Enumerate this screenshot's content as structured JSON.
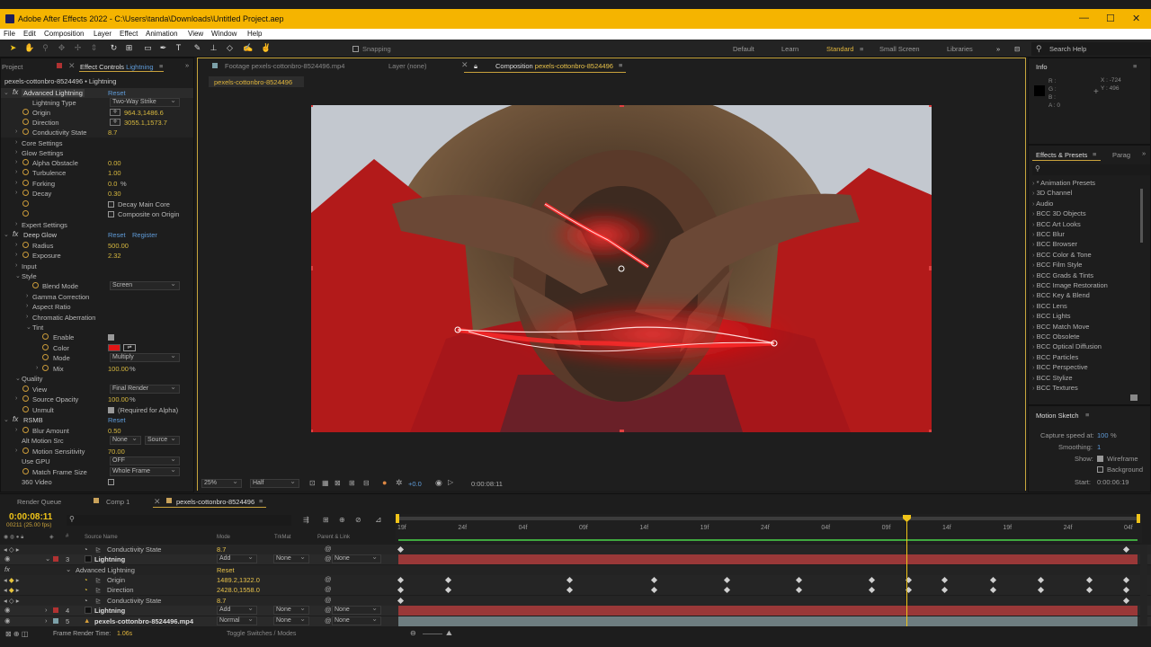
{
  "title": "Adobe After Effects 2022 - C:\\Users\\tanda\\Downloads\\Untitled Project.aep",
  "menu": [
    "File",
    "Edit",
    "Composition",
    "Layer",
    "Effect",
    "Animation",
    "View",
    "Window",
    "Help"
  ],
  "toolbar": {
    "snapping": "Snapping",
    "workspaces": [
      "Default",
      "Learn",
      "Standard",
      "Small Screen",
      "Libraries"
    ],
    "search": "Search Help"
  },
  "effect_controls": {
    "project_tab": "Project",
    "tab_prefix": "Effect Controls",
    "tab_layer": "Lightning",
    "header": "pexels-cottonbro-8524496 • Lightning",
    "advanced_lightning": "Advanced Lightning",
    "reset": "Reset",
    "register": "Register",
    "lightning_type": {
      "label": "Lightning Type",
      "value": "Two-Way Strike"
    },
    "origin": {
      "label": "Origin",
      "value": "964.3,1486.6"
    },
    "direction": {
      "label": "Direction",
      "value": "3055.1,1573.7"
    },
    "conductivity": {
      "label": "Conductivity State",
      "value": "8.7"
    },
    "core_settings": "Core Settings",
    "glow_settings": "Glow Settings",
    "alpha_obstacle": {
      "label": "Alpha Obstacle",
      "value": "0.00"
    },
    "turbulence": {
      "label": "Turbulence",
      "value": "1.00"
    },
    "forking": {
      "label": "Forking",
      "value": "0.0",
      "unit": "%"
    },
    "decay": {
      "label": "Decay",
      "value": "0.30"
    },
    "decay_main_core": "Decay Main Core",
    "composite_on_origin": "Composite on Origin",
    "expert_settings": "Expert Settings",
    "deep_glow": "Deep Glow",
    "radius": {
      "label": "Radius",
      "value": "500.00"
    },
    "exposure": {
      "label": "Exposure",
      "value": "2.32"
    },
    "input": "Input",
    "style": "Style",
    "blend_mode": {
      "label": "Blend Mode",
      "value": "Screen"
    },
    "gamma": "Gamma Correction",
    "aspect": "Aspect Ratio",
    "chromatic": "Chromatic Aberration",
    "tint": "Tint",
    "enable": "Enable",
    "color": "Color",
    "mode": {
      "label": "Mode",
      "value": "Multiply"
    },
    "mix": {
      "label": "Mix",
      "value": "100.00",
      "unit": "%"
    },
    "quality": "Quality",
    "view": {
      "label": "View",
      "value": "Final Render"
    },
    "source_opacity": {
      "label": "Source Opacity",
      "value": "100.00",
      "unit": "%"
    },
    "unmult": {
      "label": "Unmult",
      "note": "(Required for Alpha)"
    },
    "rsmb": "RSMB",
    "blur_amount": {
      "label": "Blur Amount",
      "value": "0.50"
    },
    "alt_motion": {
      "label": "Alt Motion Src",
      "value": "None",
      "value2": "Source"
    },
    "motion_sens": {
      "label": "Motion Sensitivity",
      "value": "70.00"
    },
    "use_gpu": {
      "label": "Use GPU",
      "value": "OFF"
    },
    "match_frame": {
      "label": "Match Frame Size",
      "value": "Whole Frame"
    },
    "video360": "360 Video"
  },
  "viewer": {
    "footage_tab": "Footage pexels-cottonbro-8524496.mp4",
    "layer_tab": "Layer (none)",
    "comp_prefix": "Composition",
    "comp_name": "pexels-cottonbro-8524496",
    "comp_chip": "pexels-cottonbro-8524496",
    "zoom": "25%",
    "resolution": "Half",
    "exposure": "+0.0",
    "timecode": "0:00:08:11"
  },
  "info": {
    "title": "Info",
    "labels": "R :\nG :\nB :\nA : 0",
    "x": "X : -724",
    "y": "Y : 496"
  },
  "effects_presets": {
    "tab": "Effects & Presets",
    "tab2": "Parag",
    "items": [
      "* Animation Presets",
      "3D Channel",
      "Audio",
      "BCC 3D Objects",
      "BCC Art Looks",
      "BCC Blur",
      "BCC Browser",
      "BCC Color & Tone",
      "BCC Film Style",
      "BCC Grads & Tints",
      "BCC Image Restoration",
      "BCC Key & Blend",
      "BCC Lens",
      "BCC Lights",
      "BCC Match Move",
      "BCC Obsolete",
      "BCC Optical Diffusion",
      "BCC Particles",
      "BCC Perspective",
      "BCC Stylize",
      "BCC Textures"
    ]
  },
  "motion_sketch": {
    "title": "Motion Sketch",
    "capture_label": "Capture speed at:",
    "capture": "100",
    "capture_unit": "%",
    "smoothing_label": "Smoothing:",
    "smoothing": "1",
    "show_label": "Show:",
    "wireframe": "Wireframe",
    "background": "Background",
    "start_label": "Start:",
    "start": "0:00:06:19"
  },
  "timeline": {
    "tabs": [
      "Render Queue",
      "Comp 1",
      "pexels-cottonbro-8524496"
    ],
    "timecode": "0:00:08:11",
    "frame_info": "00211 (25.00 fps)",
    "cols": {
      "source": "Source Name",
      "mode": "Mode",
      "trkmat": "TrkMat",
      "parent": "Parent & Link"
    },
    "ruler": [
      "19f",
      "24f",
      "04f",
      "09f",
      "14f",
      "19f",
      "24f",
      "04f",
      "09f",
      "14f",
      "19f",
      "24f",
      "04f"
    ],
    "rows": [
      {
        "label": "Conductivity State",
        "value": "8.7"
      },
      {
        "num": "3",
        "name": "Lightning",
        "mode": "Add",
        "trk": "None",
        "parent": "None"
      },
      {
        "label": "Advanced Lightning",
        "value": "Reset"
      },
      {
        "label": "Origin",
        "value": "1489.2,1322.0"
      },
      {
        "label": "Direction",
        "value": "2428.0,1558.0"
      },
      {
        "label": "Conductivity State",
        "value": "8.7"
      },
      {
        "num": "4",
        "name": "Lightning",
        "mode": "Add",
        "trk": "None",
        "parent": "None"
      },
      {
        "num": "5",
        "name": "pexels-cottonbro-8524496.mp4",
        "mode": "Normal",
        "trk": "None",
        "parent": "None"
      }
    ],
    "render_time_label": "Frame Render Time:",
    "render_time": "1.06s",
    "toggle": "Toggle Switches / Modes"
  }
}
